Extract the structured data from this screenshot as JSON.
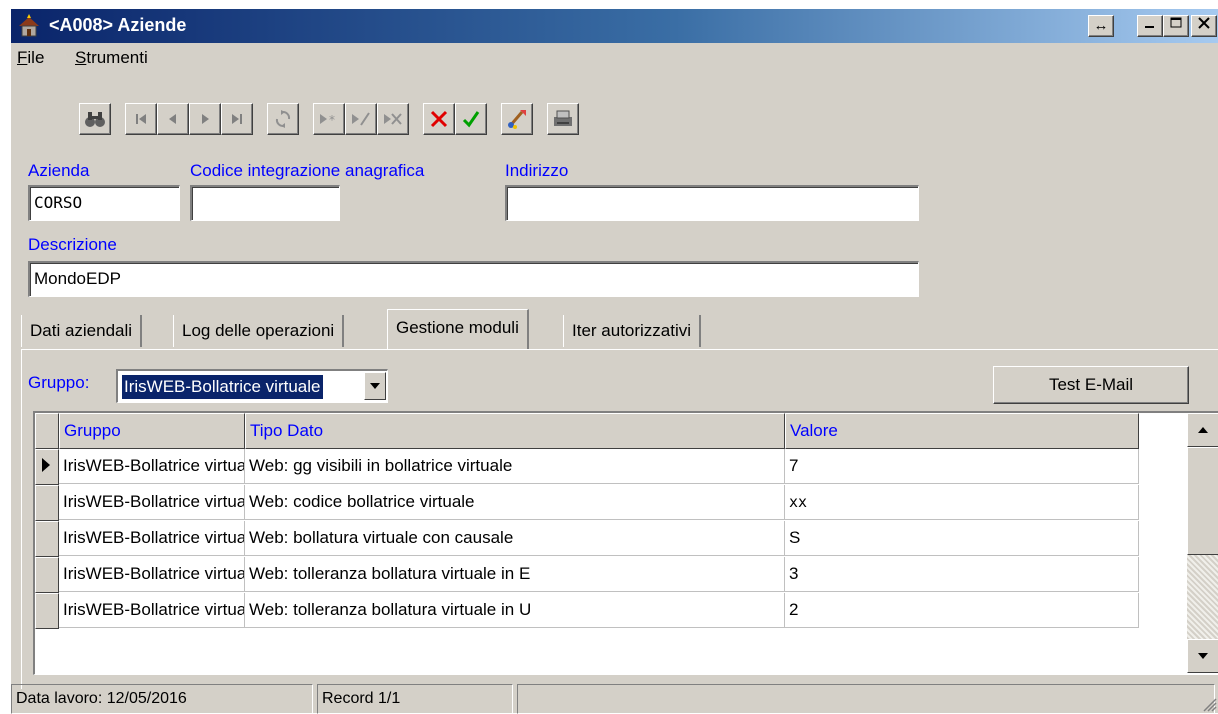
{
  "window": {
    "title": "<A008> Aziende",
    "controls": {
      "restore": "↔",
      "minimize": "_",
      "maximize": "□",
      "close": "X"
    }
  },
  "menu": [
    {
      "label": "File",
      "accel": "F",
      "rest": "ile"
    },
    {
      "label": "Strumenti",
      "accel": "S",
      "rest": "trumenti"
    }
  ],
  "toolbar": {
    "icons": [
      "binoculars-search-icon",
      "first-record-icon",
      "prev-record-icon",
      "next-record-icon",
      "last-record-icon",
      "refresh-icon",
      "new-record-icon",
      "edit-record-icon",
      "delete-record-icon",
      "cancel-icon",
      "confirm-icon",
      "clear-icon",
      "print-icon"
    ]
  },
  "form": {
    "azienda": {
      "label": "Azienda",
      "value": "CORSO"
    },
    "codice_integrazione": {
      "label": "Codice integrazione anagrafica",
      "value": ""
    },
    "indirizzo": {
      "label": "Indirizzo",
      "value": ""
    },
    "descrizione": {
      "label": "Descrizione",
      "value": "MondoEDP"
    }
  },
  "tabs": [
    {
      "label": "Dati aziendali",
      "active": false
    },
    {
      "label": "Log delle operazioni",
      "active": false
    },
    {
      "label": "Gestione moduli",
      "active": true
    },
    {
      "label": "Iter autorizzativi",
      "active": false
    }
  ],
  "gestione_moduli": {
    "gruppo_label": "Gruppo:",
    "gruppo_value": "IrisWEB-Bollatrice virtuale",
    "test_email_label": "Test E-Mail",
    "grid": {
      "columns": [
        "Gruppo",
        "Tipo Dato",
        "Valore"
      ],
      "rows": [
        {
          "gruppo": "IrisWEB-Bollatrice virtuale",
          "tipo": "Web: gg visibili in bollatrice virtuale",
          "valore": "7",
          "current": true
        },
        {
          "gruppo": "IrisWEB-Bollatrice virtuale",
          "tipo": "Web: codice bollatrice virtuale",
          "valore": "xx",
          "current": false
        },
        {
          "gruppo": "IrisWEB-Bollatrice virtuale",
          "tipo": "Web: bollatura virtuale con causale",
          "valore": "S",
          "current": false
        },
        {
          "gruppo": "IrisWEB-Bollatrice virtuale",
          "tipo": "Web: tolleranza bollatura virtuale in E",
          "valore": "3",
          "current": false
        },
        {
          "gruppo": "IrisWEB-Bollatrice virtuale",
          "tipo": "Web: tolleranza bollatura virtuale in U",
          "valore": "2",
          "current": false
        }
      ]
    }
  },
  "status": {
    "data_lavoro": "Data lavoro: 12/05/2016",
    "record": "Record 1/1",
    "extra": ""
  },
  "colors": {
    "title_gradient_start": "#0a246a",
    "title_gradient_end": "#a6caf0",
    "label_blue": "#0000ff",
    "face": "#d4d0c8",
    "cancel_red": "#e00000",
    "confirm_green": "#00a000"
  }
}
